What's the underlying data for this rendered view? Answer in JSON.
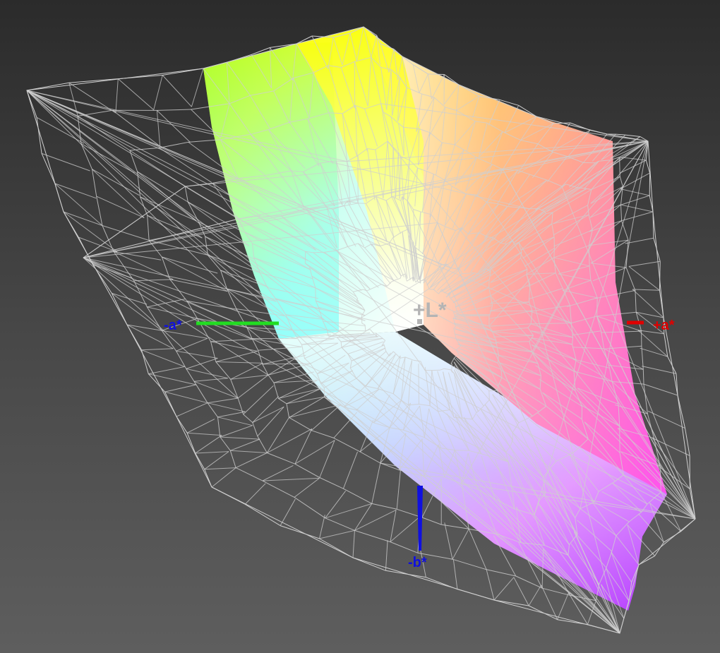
{
  "axes": {
    "plus_L": {
      "label": "+L*",
      "color": "#b4b4b4"
    },
    "minus_a": {
      "label": "-a*",
      "color": "#1010e0",
      "line_color": "#22dd22"
    },
    "plus_a": {
      "label": "+a*",
      "color": "#e00000",
      "line_color": "#e00000"
    },
    "minus_b": {
      "label": "-b*",
      "color": "#1010e0",
      "line_color": "#1010e0"
    }
  },
  "colors": {
    "wireframe": "#cfcfcf",
    "background_top": "#2b2b2b",
    "background_bottom": "#5e5e5e"
  }
}
